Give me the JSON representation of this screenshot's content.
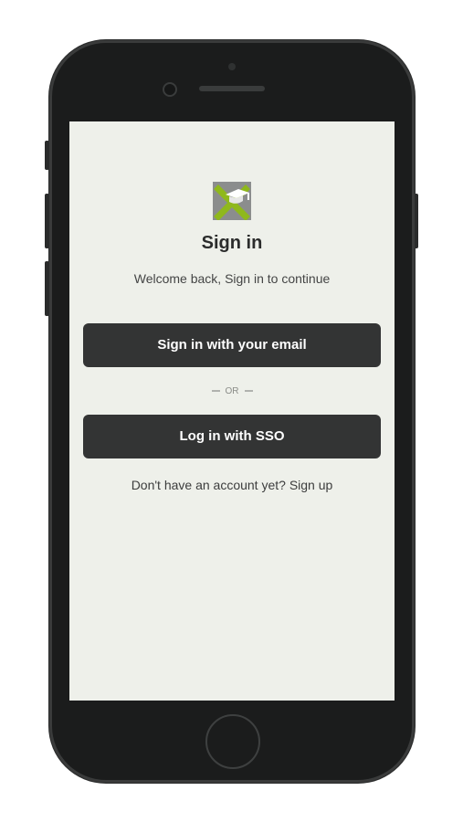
{
  "logo": {
    "icon": "graduation-cap-x-logo",
    "colors": {
      "background": "#8b8d8d",
      "x": "#8fb81c",
      "cap": "#ffffff"
    }
  },
  "auth": {
    "title": "Sign in",
    "subtitle": "Welcome back, Sign in to continue",
    "email_button_label": "Sign in with your email",
    "divider_label": "OR",
    "sso_button_label": "Log in with SSO",
    "signup_prompt": "Don't have an account yet?",
    "signup_link": "Sign up"
  },
  "colors": {
    "button_bg": "#333434",
    "screen_bg": "#eef0ea",
    "phone_body": "#1b1c1c"
  }
}
